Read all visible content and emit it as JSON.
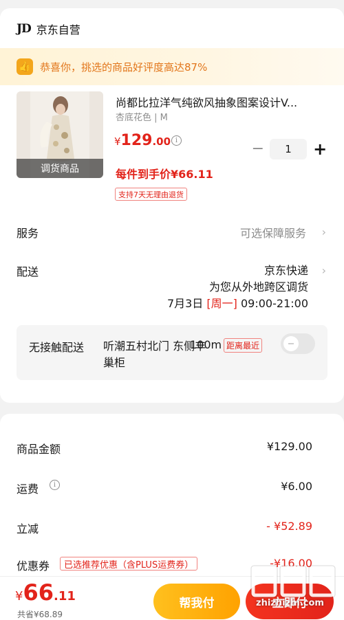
{
  "store": {
    "logo": "JD",
    "name": "京东自营"
  },
  "banner": {
    "text": "恭喜你，挑选的商品好评度高达87%"
  },
  "product": {
    "image_badge": "调货商品",
    "title": "尚都比拉洋气纯欲风抽象图案设计V...",
    "spec": "杏底花色 | M",
    "price_symbol": "¥",
    "price_int": "129",
    "price_dec": ".00",
    "unit_price": "每件到手价¥66.11",
    "return_tag": "支持7天无理由退货",
    "quantity": "1",
    "minus": "−",
    "plus": "+"
  },
  "service": {
    "label": "服务",
    "value": "可选保障服务"
  },
  "delivery": {
    "label": "配送",
    "carrier": "京东快递",
    "note": "为您从外地跨区调货",
    "date": "7月3日",
    "weekday": "[周一]",
    "time": "09:00-21:00"
  },
  "contactless": {
    "label": "无接触配送",
    "location": "听潮五村北门 东侧丰巢柜",
    "distance": "100m",
    "nearest_tag": "距离最近",
    "enabled": false
  },
  "summary": {
    "goods_label": "商品金额",
    "goods_value": "¥129.00",
    "shipping_label": "运费",
    "shipping_value": "¥6.00",
    "discount_label": "立减",
    "discount_value": "- ¥52.89",
    "coupon_label": "优惠券",
    "coupon_tag": "已选推荐优惠（含PLUS运费券）",
    "coupon_value": "-¥16.00"
  },
  "bottom": {
    "total_symbol": "¥",
    "total_int": "66",
    "total_dec": ".11",
    "saved": "共省¥68.89",
    "help_button": "帮我付",
    "pay_button": "立即付"
  },
  "watermark": {
    "text": "zhizhizhi.com"
  },
  "colors": {
    "accent_red": "#e2231a",
    "accent_yellow": "#ffb400",
    "banner_text": "#e2761b"
  }
}
